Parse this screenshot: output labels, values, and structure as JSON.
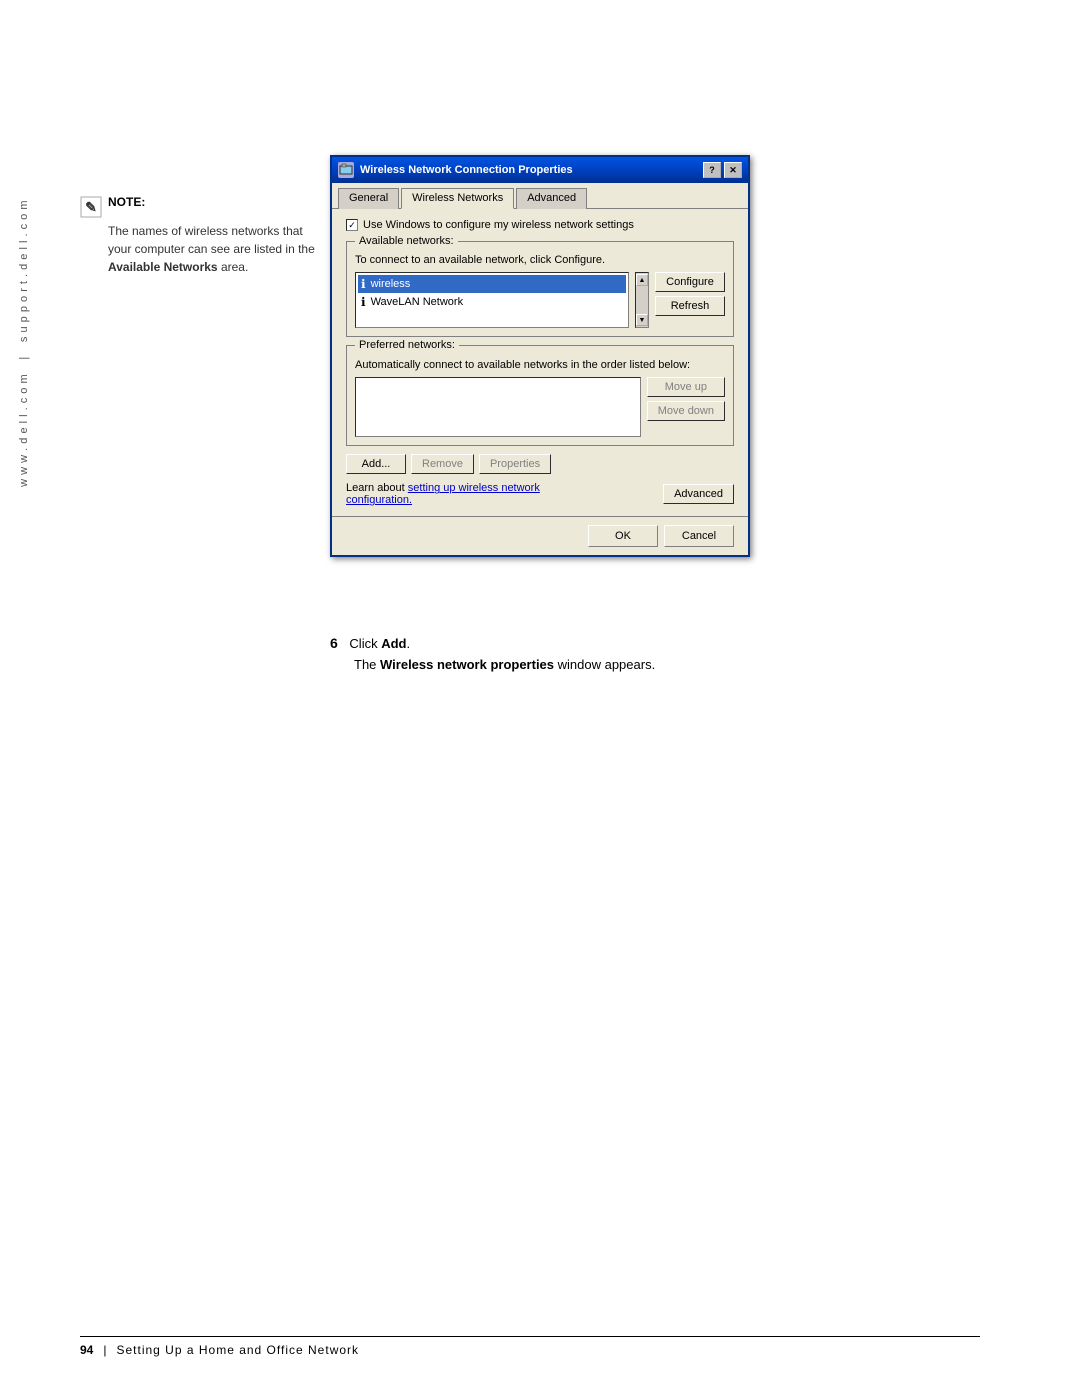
{
  "sidebar": {
    "text1": "w w w . d e l l . c o m",
    "text2": "s u p p o r t . d e l l . c o m"
  },
  "note": {
    "label": "NOTE:",
    "body": "The names of wireless networks that your computer can see are listed in the ",
    "bold_text": "Available Networks",
    "body_end": " area."
  },
  "dialog": {
    "title": "Wireless Network Connection Properties",
    "tabs": {
      "general": "General",
      "wireless_networks": "Wireless Networks",
      "advanced": "Advanced"
    },
    "checkbox_label": "Use Windows to configure my wireless network settings",
    "available_networks": {
      "group_label": "Available networks:",
      "description": "To connect to an available network, click Configure.",
      "networks": [
        {
          "name": "wireless",
          "icon": "i"
        },
        {
          "name": "WaveLAN Network",
          "icon": "i"
        }
      ],
      "configure_btn": "Configure",
      "refresh_btn": "Refresh"
    },
    "preferred_networks": {
      "group_label": "Preferred networks:",
      "description": "Automatically connect to available networks in the order listed below:",
      "move_up_btn": "Move up",
      "move_down_btn": "Move down"
    },
    "bottom_buttons": {
      "add_btn": "Add...",
      "remove_btn": "Remove",
      "properties_btn": "Properties"
    },
    "learn_text": "Learn about ",
    "learn_link": "setting up wireless network configuration.",
    "advanced_btn": "Advanced",
    "footer": {
      "ok_btn": "OK",
      "cancel_btn": "Cancel"
    }
  },
  "step": {
    "number": "6",
    "text_prefix": "Click ",
    "text_bold": "Add",
    "text_suffix": ".",
    "subtext_prefix": "The ",
    "subtext_bold": "Wireless network properties",
    "subtext_suffix": " window appears."
  },
  "footer": {
    "page_number": "94",
    "divider": "|",
    "chapter": "Setting Up a Home and Office Network"
  }
}
